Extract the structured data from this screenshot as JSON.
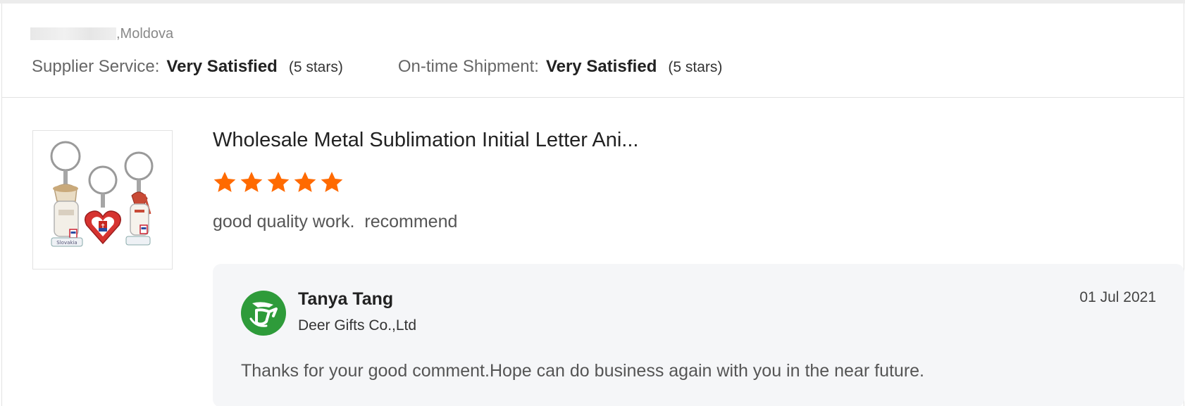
{
  "location": {
    "suffix": ",Moldova"
  },
  "ratings": {
    "supplier_service": {
      "label": "Supplier Service:",
      "value": "Very Satisfied",
      "stars_text": "(5 stars)"
    },
    "on_time_shipment": {
      "label": "On-time Shipment:",
      "value": "Very Satisfied",
      "stars_text": "(5 stars)"
    }
  },
  "product": {
    "title": "Wholesale Metal Sublimation Initial Letter Ani...",
    "image_icon": "keychain-product-thumbnail",
    "image_label": "Slovakia",
    "rating": 5,
    "star_color": "#ff6a00"
  },
  "review": {
    "text": "good quality work.  recommend"
  },
  "reply": {
    "name": "Tanya Tang",
    "company": "Deer Gifts Co.,Ltd",
    "date": "01 Jul 2021",
    "text": "Thanks for your good comment.Hope can do business again with you in the near future.",
    "avatar_icon": "deer-logo-icon",
    "avatar_color": "#2e9b3a"
  }
}
